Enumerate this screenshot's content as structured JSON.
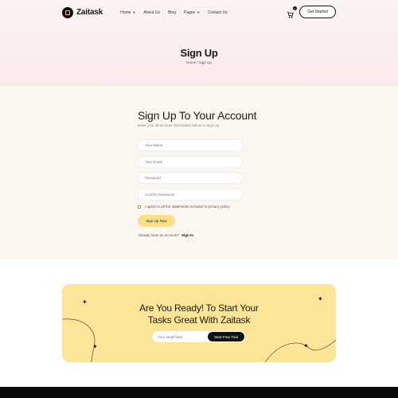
{
  "brand": {
    "name": "Zaitask"
  },
  "nav": {
    "items": [
      {
        "label": "Home",
        "has_dropdown": true
      },
      {
        "label": "About Us",
        "has_dropdown": false
      },
      {
        "label": "Blog",
        "has_dropdown": false
      },
      {
        "label": "Pages",
        "has_dropdown": true
      },
      {
        "label": "Contact Us",
        "has_dropdown": false
      }
    ],
    "cart_count": "0",
    "cta_label": "Get Started"
  },
  "hero": {
    "title": "Sign Up",
    "breadcrumb": "Home / Sign Up"
  },
  "form": {
    "title": "Sign Up To Your Account",
    "subtitle": "Enter your all account information below to Sign Up.",
    "fields": [
      {
        "placeholder": "Your Name"
      },
      {
        "placeholder": "Your Email"
      },
      {
        "placeholder": "Password"
      },
      {
        "placeholder": "Confirm Password"
      }
    ],
    "agree_label": "I agree to all the statements included in privacy policy",
    "submit_label": "Sign Up Now",
    "signin_prompt": "Already have an account?",
    "signin_link": "Sign In"
  },
  "cta": {
    "title_line1": "Are You Ready! To Start Your",
    "title_line2": "Tasks Great With Zaitask",
    "email_placeholder": "Your email here",
    "button_label": "Start Free Trial"
  },
  "colors": {
    "accent_yellow": "#fde598",
    "button_yellow": "#fbe089",
    "dark": "#111111"
  }
}
